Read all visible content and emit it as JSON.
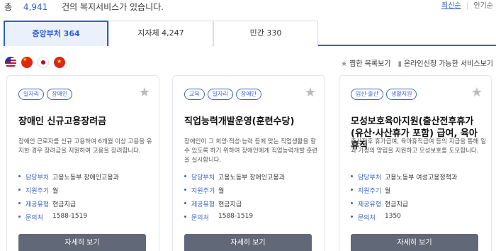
{
  "summary": {
    "prefix": "총",
    "total": "4,941",
    "suffix": "건의 복지서비스가 있습니다."
  },
  "sort": {
    "latest": "최신순",
    "separator": "|",
    "popular": "인기순"
  },
  "tabs": [
    {
      "label": "중앙부처 364"
    },
    {
      "label": "지자체 4,247"
    },
    {
      "label": "민간 330"
    }
  ],
  "languages": [
    "english-flag",
    "chinese-flag",
    "japanese-flag",
    "vietnamese-flag"
  ],
  "filters": {
    "favorites": "찜한 목록보기",
    "online": "온라인신청 가능한 서비스보기"
  },
  "colors": {
    "accent": "#2c5fcf",
    "button": "#616877",
    "tag": "#3d63c9"
  },
  "cards": [
    {
      "tags": [
        "일자리",
        "장애인"
      ],
      "title": "장애인 신규고용장려금",
      "desc": "장애인 근로자를 신규 고용하여 6개월 이상 고용을 유지한 경우 장려금을 지원하여 고용을 장려합니다.",
      "info": [
        {
          "label": "담당부처",
          "value": "고용노동부 장애인고용과"
        },
        {
          "label": "지원주기",
          "value": "월"
        },
        {
          "label": "제공유형",
          "value": "현금지급"
        },
        {
          "label": "문의처",
          "value": "1588-1519"
        }
      ],
      "button": "자세히 보기"
    },
    {
      "tags": [
        "교육",
        "일자리",
        "장애인"
      ],
      "title": "직업능력개발운영(훈련수당)",
      "desc": "장애인이 그 희망·적성·능력 등에 맞는 직업생활을 할 수 있도록 하기 위하여 장애인에게 직업능력개발 훈련을 실시합니다.",
      "info": [
        {
          "label": "담당부처",
          "value": "고용노동부 장애인고용과"
        },
        {
          "label": "지원주기",
          "value": "월"
        },
        {
          "label": "제공유형",
          "value": "현금지급"
        },
        {
          "label": "문의처",
          "value": "1588-1519"
        }
      ],
      "button": "자세히 보기"
    },
    {
      "tags": [
        "임신·출산",
        "생활지원"
      ],
      "title": "모성보호육아지원(출산전후휴가(유산·사산휴가 포함) 급여, 육아휴직",
      "desc": "출산전후 휴가급여, 육아휴직급여 등의 지급을 통해 일과 가정의 양립을 지원하고 모성보호를 도모합니다.",
      "info": [
        {
          "label": "담당부처",
          "value": "고용노동부 여성고용정책과"
        },
        {
          "label": "지원주기",
          "value": "월"
        },
        {
          "label": "제공유형",
          "value": "현금지급"
        },
        {
          "label": "문의처",
          "value": "1350"
        }
      ],
      "button": "자세히 보기"
    }
  ]
}
